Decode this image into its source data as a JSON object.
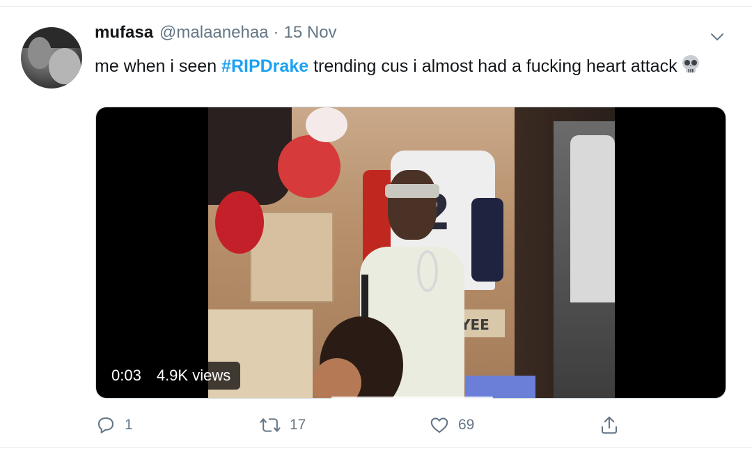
{
  "tweet": {
    "display_name": "mufasa",
    "handle": "@malaanehaa",
    "separator": "·",
    "date": "15 Nov",
    "text_before": "me when i seen ",
    "hashtag": "#RIPDrake",
    "text_after": " trending cus i almost had a fucking heart attack",
    "emoji": "skull-emoji"
  },
  "media": {
    "type": "video",
    "time": "0:03",
    "views": "4.9K views",
    "progress": 0.0,
    "scene_text": {
      "jersey_number": "2",
      "sign": "YEE"
    }
  },
  "actions": {
    "reply_count": "1",
    "retweet_count": "17",
    "like_count": "69"
  },
  "icons": {
    "caret": "chevron-down-icon",
    "reply": "reply-icon",
    "retweet": "retweet-icon",
    "like": "heart-icon",
    "share": "share-icon"
  },
  "colors": {
    "accent": "#1da1f2",
    "secondary_text": "#657786",
    "primary_text": "#14171a"
  }
}
